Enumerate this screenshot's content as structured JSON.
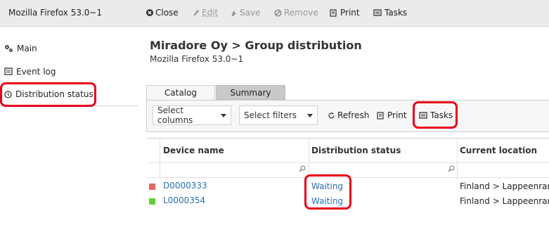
{
  "app": {
    "title": "Mozilla Firefox 53.0~1"
  },
  "toolbar": {
    "close": "Close",
    "edit": "Edit",
    "save": "Save",
    "remove": "Remove",
    "print": "Print",
    "tasks": "Tasks"
  },
  "sidebar": {
    "items": [
      {
        "label": "Main",
        "icon": "gears-icon"
      },
      {
        "label": "Event log",
        "icon": "log-icon"
      },
      {
        "label": "Distribution status",
        "icon": "clock-icon",
        "active": true
      }
    ]
  },
  "main": {
    "title": "Miradore Oy > Group distribution",
    "subtitle": "Mozilla Firefox 53.0~1"
  },
  "tabs": [
    {
      "label": "Catalog",
      "active": true
    },
    {
      "label": "Summary",
      "active": false
    }
  ],
  "actions": {
    "select_columns": "Select columns",
    "select_filters": "Select filters",
    "refresh": "Refresh",
    "print": "Print",
    "tasks": "Tasks"
  },
  "table": {
    "headers": [
      "Device name",
      "Distribution status",
      "Current location"
    ],
    "rows": [
      {
        "device": "D0000333",
        "status": "Waiting",
        "location": "Finland > Lappeenranta >",
        "indicator_color": "#e06666"
      },
      {
        "device": "L0000354",
        "status": "Waiting",
        "location": "Finland > Lappeenranta >",
        "indicator_color": "#5fd13a"
      }
    ]
  },
  "colors": {
    "highlight": "#e8001a",
    "link": "#2a6fb5",
    "toolbar_bg": "#ebebeb"
  }
}
